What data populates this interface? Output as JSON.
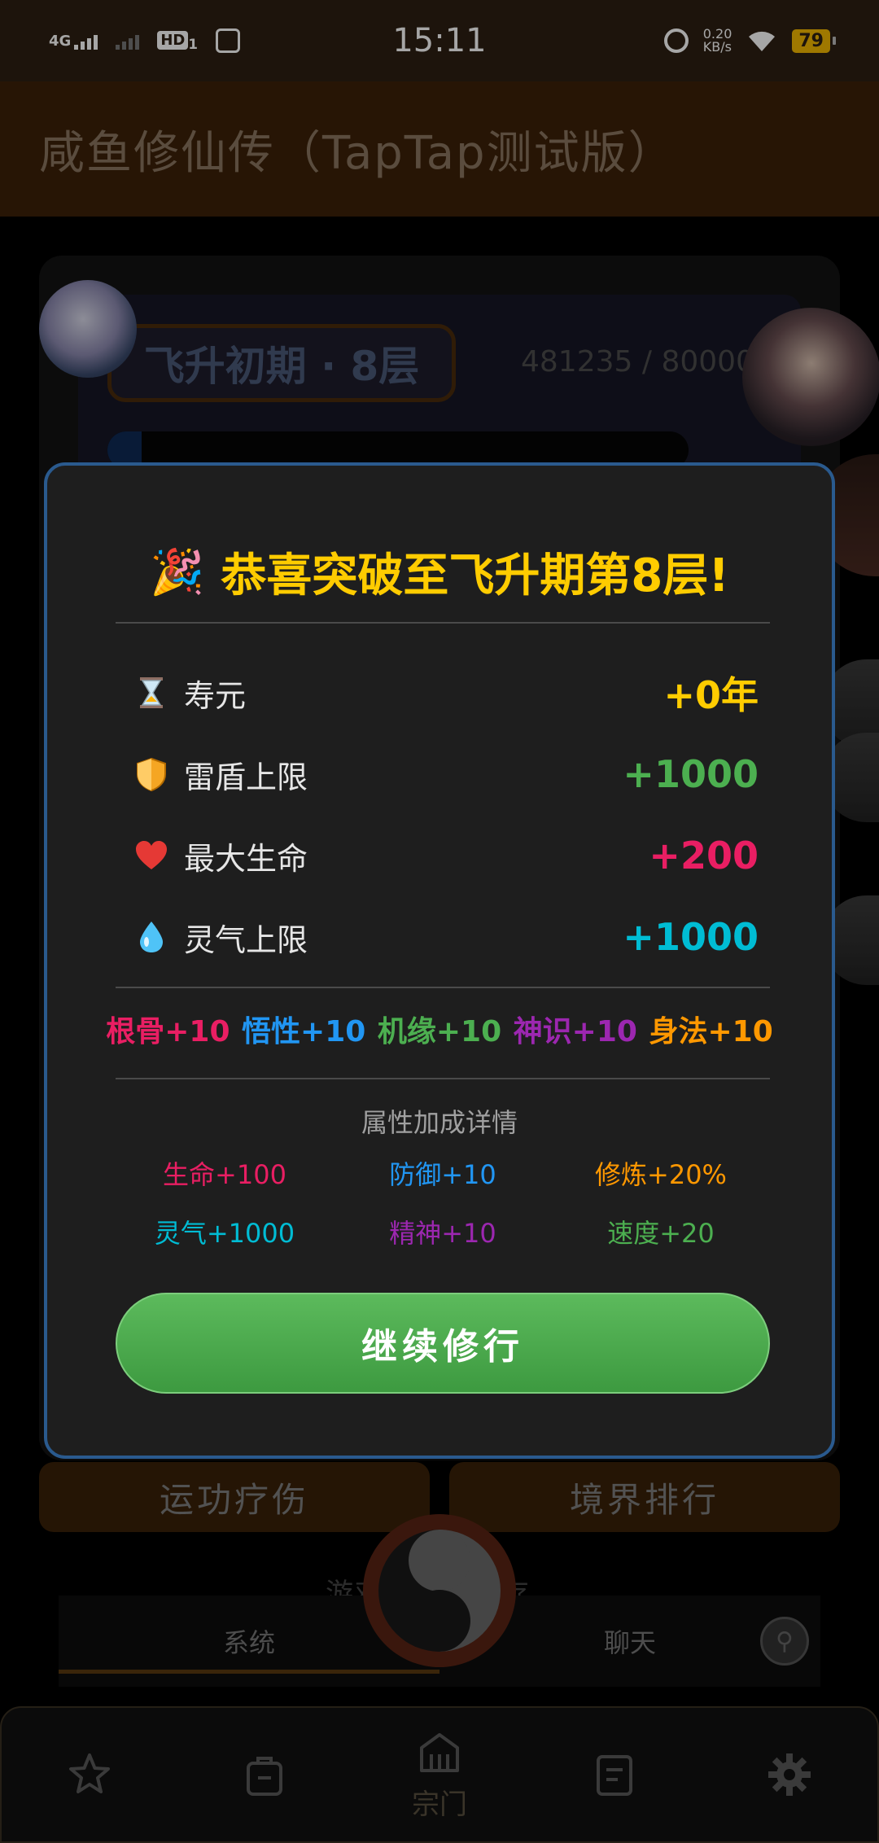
{
  "status_bar": {
    "network": "4G",
    "hd_label": "HD",
    "hd_sub": "1",
    "time": "15:11",
    "speed_value": "0.20",
    "speed_unit": "KB/s",
    "battery": "79"
  },
  "app_bar": {
    "title": "咸鱼修仙传（TapTap测试版）"
  },
  "background": {
    "realm_label": "飞升初期 · 8层",
    "exp_text": "481235 / 800000",
    "buttons": [
      "运功疗伤",
      "境界排行"
    ],
    "log_text": "游戏已自动保存",
    "tabs": [
      "系统",
      "聊天"
    ]
  },
  "modal": {
    "title": "恭喜突破至飞升期第8层!",
    "stats": [
      {
        "icon": "hourglass-icon",
        "label": "寿元",
        "value": "+0年",
        "color": "#ffcc00"
      },
      {
        "icon": "shield-icon",
        "label": "雷盾上限",
        "value": "+1000",
        "color": "#4caf50"
      },
      {
        "icon": "heart-icon",
        "label": "最大生命",
        "value": "+200",
        "color": "#e91e63"
      },
      {
        "icon": "droplet-icon",
        "label": "灵气上限",
        "value": "+1000",
        "color": "#00bcd4"
      }
    ],
    "attributes": [
      {
        "text": "根骨+10",
        "color": "#e91e63"
      },
      {
        "text": "悟性+10",
        "color": "#2196f3"
      },
      {
        "text": "机缘+10",
        "color": "#4caf50"
      },
      {
        "text": "神识+10",
        "color": "#9c27b0"
      },
      {
        "text": "身法+10",
        "color": "#ff9800"
      }
    ],
    "detail_title": "属性加成详情",
    "details": [
      {
        "text": "生命+100",
        "color": "#e91e63"
      },
      {
        "text": "防御+10",
        "color": "#2196f3"
      },
      {
        "text": "修炼+20%",
        "color": "#ff9800"
      },
      {
        "text": "灵气+1000",
        "color": "#00bcd4"
      },
      {
        "text": "精神+10",
        "color": "#9c27b0"
      },
      {
        "text": "速度+20",
        "color": "#4caf50"
      }
    ],
    "continue_label": "继续修行"
  },
  "bottom_nav": {
    "items": [
      {
        "icon": "star-icon",
        "label": ""
      },
      {
        "icon": "bag-icon",
        "label": ""
      },
      {
        "icon": "sect-icon",
        "label": "宗门"
      },
      {
        "icon": "document-icon",
        "label": ""
      },
      {
        "icon": "gear-icon",
        "label": ""
      }
    ]
  }
}
